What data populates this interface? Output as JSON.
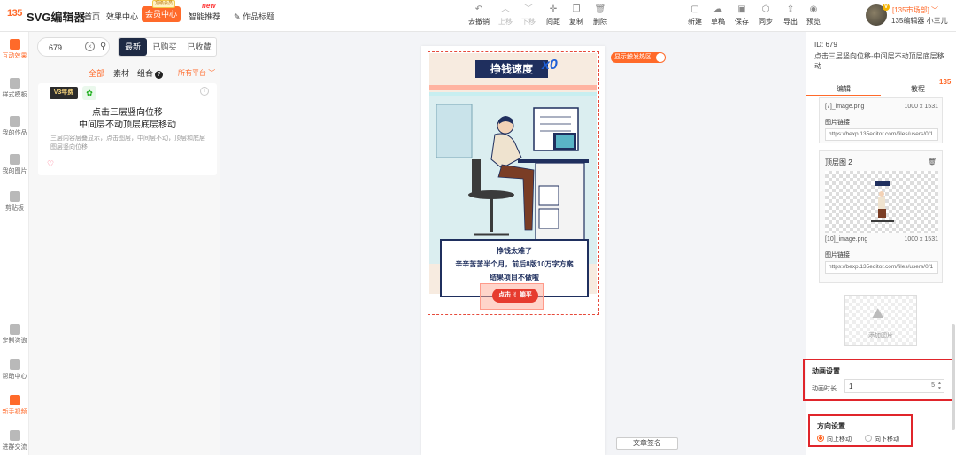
{
  "brand": {
    "logo": "135",
    "title": "SVG编辑器"
  },
  "nav": {
    "home": "首页",
    "effects": "效果中心",
    "vip": "会员中心",
    "vip_tag": "顶级会员",
    "smart": "智能推荐",
    "new_tag": "new"
  },
  "doc_title": "作品标题",
  "toolbar": {
    "undo": "去撤销",
    "up": "上移",
    "down": "下移",
    "spacing": "间距",
    "copy": "复制",
    "delete": "删除",
    "new": "新建",
    "draft": "草稿",
    "save": "保存",
    "sync": "同步",
    "export": "导出",
    "preview": "预览"
  },
  "user": {
    "area": "[135市场部]",
    "name": "135编辑器 小三儿",
    "vip_badge": "V"
  },
  "leftnav": [
    {
      "label": "互动效果",
      "active": true
    },
    {
      "label": "样式模板",
      "active": false
    },
    {
      "label": "我的作品",
      "active": false
    },
    {
      "label": "我的图片",
      "active": false
    },
    {
      "label": "剪贴板",
      "active": false
    },
    {
      "label": "定制咨询",
      "active": false
    },
    {
      "label": "帮助中心",
      "active": false
    },
    {
      "label": "新手视频",
      "active": false
    },
    {
      "label": "进群交流",
      "active": false
    }
  ],
  "search": {
    "value": "679"
  },
  "filters": {
    "newest": "最新",
    "bought": "已购买",
    "collected": "已收藏"
  },
  "categories": {
    "all": "全部",
    "material": "素材",
    "combo": "组合",
    "help": "?",
    "platform": "所有平台"
  },
  "card": {
    "badge": "V3年费",
    "wx": "✿",
    "title_line1": "点击三层竖向位移",
    "title_line2": "中间层不动顶层底层移动",
    "desc": "三层内容层叠显示，点击图层，中间层不动，顶层和底层图层竖向位移",
    "heart": "♡"
  },
  "canvas": {
    "hot_toggle": "显示触发热区",
    "illus_title": "挣钱速度",
    "illus_x": "x0",
    "text_line1": "挣钱太难了",
    "text_line2": "辛辛苦苦半个月，前后8版10万字方案",
    "text_line3": "结果项目不做啦",
    "cta": "点击 ✌ 躺平",
    "signature": "文章签名"
  },
  "right": {
    "id": "ID: 679",
    "name": "点击三层竖向位移-中间层不动顶层底层移动",
    "logo": "135",
    "tab_edit": "编辑",
    "tab_tutorial": "教程",
    "img1": {
      "file": "[7]_image.png",
      "dim": "1000 x 1531",
      "link_label": "图片链接",
      "link": "https://bexp.135editor.com/files/users/0/1"
    },
    "img2": {
      "title": "顶层图 2",
      "file": "[10]_image.png",
      "dim": "1000 x 1531",
      "link_label": "图片链接",
      "link": "https://bexp.135editor.com/files/users/0/1"
    },
    "add_image": "添加图片",
    "anim": {
      "title": "动画设置",
      "label": "动画时长",
      "value": "1",
      "max": "5"
    },
    "direction": {
      "title": "方向设置",
      "up": "向上移动",
      "down": "向下移动",
      "selected": "up"
    }
  },
  "colors": {
    "accent": "#ff6a2a",
    "navy": "#1f2f5e",
    "highlight": "#e0252b"
  }
}
